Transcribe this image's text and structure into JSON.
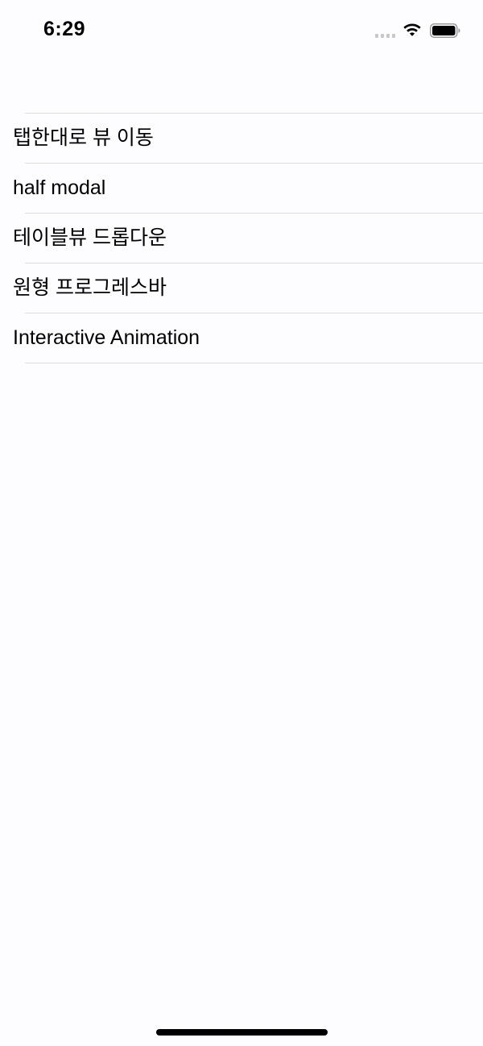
{
  "status_bar": {
    "time": "6:29"
  },
  "table": {
    "rows": [
      {
        "label": "탭한대로 뷰 이동"
      },
      {
        "label": "half modal"
      },
      {
        "label": "테이블뷰 드롭다운"
      },
      {
        "label": "원형 프로그레스바"
      },
      {
        "label": "Interactive Animation"
      }
    ]
  },
  "colors": {
    "background": "#fdfcfe",
    "separator": "#dcdcdf",
    "text": "#000000"
  }
}
